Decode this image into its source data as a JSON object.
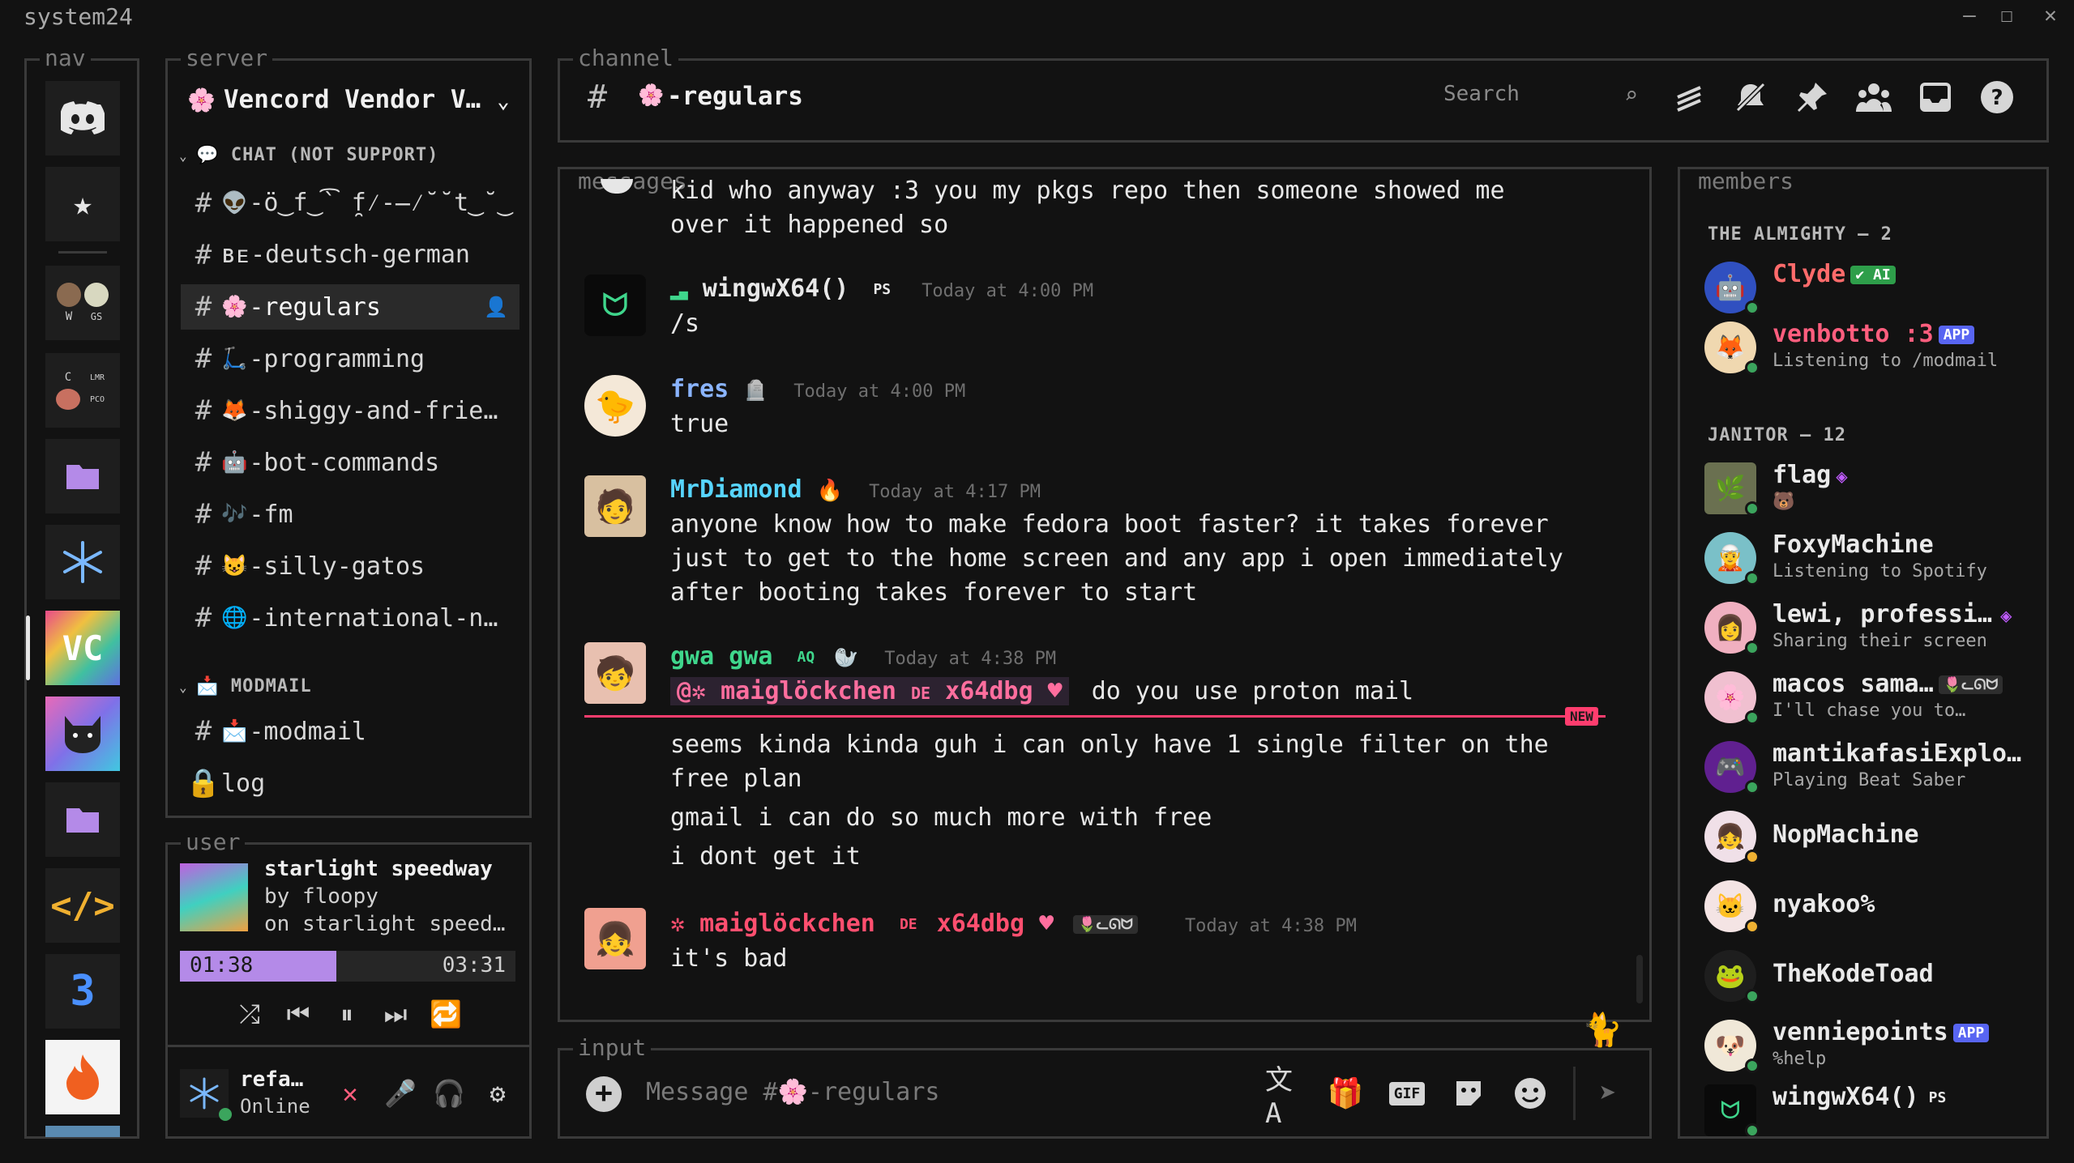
{
  "app_title": "system24",
  "window": {
    "minimize": "—",
    "maximize": "☐",
    "close": "✕"
  },
  "sections": {
    "nav": "nav",
    "server": "server",
    "channel": "channel",
    "messages": "messages",
    "members": "members",
    "user": "user",
    "input": "input"
  },
  "nav": {
    "tiles": [
      {
        "name": "home-discord-icon",
        "label": ""
      },
      {
        "name": "favorites-star-icon",
        "label": "★"
      },
      {
        "name": "server-folder-w-gs",
        "labels": [
          "W",
          "GS"
        ]
      },
      {
        "name": "server-folder-c-lmr-pco",
        "labels": [
          "C",
          "LMR",
          "PCO"
        ]
      },
      {
        "name": "folder-icon",
        "label": ""
      },
      {
        "name": "vencord-server-icon",
        "label": ""
      },
      {
        "name": "vc-server-icon",
        "label": ""
      },
      {
        "name": "cat-server-icon",
        "label": ""
      },
      {
        "name": "folder-icon",
        "label": ""
      },
      {
        "name": "code-server-icon",
        "label": "</>"
      },
      {
        "name": "b3-server-icon",
        "label": "3"
      },
      {
        "name": "fire-server-icon",
        "label": ""
      }
    ]
  },
  "server": {
    "name": "Vencord Vendor V…",
    "categories": [
      {
        "label": "CHAT (NOT SUPPORT)",
        "icon": "💬"
      },
      {
        "label": "MODMAIL",
        "icon": "📩"
      }
    ],
    "channels": [
      {
        "emoji": "👽",
        "label": "-ö‿f‿̀͡ ̯f⁄-̶⁄˘˘t‿˘‿",
        "unread": true
      },
      {
        "emoji": "",
        "label": "ʙᴇ-deutsch-german",
        "unread": true
      },
      {
        "emoji": "🌸",
        "label": "-regulars",
        "selected": true
      },
      {
        "emoji": "🛴",
        "label": "-programming"
      },
      {
        "emoji": "🦊",
        "label": "-shiggy-and-frie…",
        "unread": true
      },
      {
        "emoji": "🤖",
        "label": "-bot-commands",
        "unread": true
      },
      {
        "emoji": "🎶",
        "label": "-fm",
        "unread": true
      },
      {
        "emoji": "😺",
        "label": "-silly-gatos",
        "unread": true
      },
      {
        "emoji": "🌐",
        "label": "-international-n…",
        "unread": true
      },
      {
        "emoji": "📩",
        "label": "-modmail"
      },
      {
        "emoji": "",
        "label": "log",
        "locked": true
      }
    ]
  },
  "header": {
    "channel_emoji": "🌸",
    "channel_name": "-regulars",
    "search_placeholder": "Search"
  },
  "messages": {
    "top_lines": [
      "kid who anyway :3 you my pkgs repo then someone showed me",
      "over it happened so"
    ],
    "items": [
      {
        "author": "wingwX64()",
        "tag": "PS",
        "time": "Today at 4:00 PM",
        "color": "#e8e8e8",
        "lines": [
          "/s"
        ]
      },
      {
        "author": "fres",
        "time": "Today at 4:00 PM",
        "color": "#8ab4ff",
        "lines": [
          "true"
        ]
      },
      {
        "author": "MrDiamond",
        "time": "Today at 4:17 PM",
        "color": "#57d5ff",
        "lines": [
          "anyone know how to make fedora boot faster? it takes forever",
          "just to get to the home screen and any app i open immediately",
          "after booting takes forever to start"
        ]
      },
      {
        "author": "gwa gwa",
        "tag": "AQ",
        "time": "Today at 4:38 PM",
        "color": "#3fd68c",
        "mention": "@✲ maiglöckchen",
        "mention_tag": "DE",
        "mention_suffix": "x64dbg",
        "mention_text": "do you use proton mail",
        "lines": [
          "seems kinda kinda guh i can only have 1 single filter on the",
          "free plan",
          "gmail i can do so much more with free",
          "i dont get it"
        ]
      },
      {
        "author": "maiglöckchen",
        "prefix": "✲",
        "tag": "DE",
        "suffix": "x64dbg",
        "badge": "🌷ᓚᘏᗢ",
        "time": "Today at 4:38 PM",
        "color": "#ff4f6f",
        "lines": [
          "it's bad"
        ]
      }
    ],
    "new_label": "NEW"
  },
  "input": {
    "placeholder": "Message #🌸-regulars"
  },
  "members": {
    "groups": [
      {
        "label": "THE ALMIGHTY — 2",
        "members": [
          {
            "name": "Clyde",
            "color": "#ff6b6b",
            "tag": "✔ AI",
            "tag_color": "#2e9e4a",
            "status": "online"
          },
          {
            "name": "venbotto :3",
            "color": "#ff5e7e",
            "tag": "APP",
            "tag_color": "#5865f2",
            "sub": "Listening to /modmail",
            "status": "online"
          }
        ]
      },
      {
        "label": "JANITOR — 12",
        "members": [
          {
            "name": "flag",
            "color": "#eaeaea",
            "sub": "🐻",
            "status": "online"
          },
          {
            "name": "FoxyMachine",
            "color": "#eaeaea",
            "sub": "Listening to Spotify",
            "status": "online"
          },
          {
            "name": "lewi, professi…",
            "color": "#eaeaea",
            "sub": "Sharing their screen",
            "status": "online"
          },
          {
            "name": "macos sama…",
            "color": "#eaeaea",
            "tag": "🌷ᓚᘏᗢ",
            "sub": "I'll chase you to…",
            "status": "online"
          },
          {
            "name": "mantikafasiExplo…",
            "color": "#eaeaea",
            "sub": "Playing Beat Saber",
            "status": "online"
          },
          {
            "name": "NopMachine",
            "color": "#eaeaea",
            "status": "idle"
          },
          {
            "name": "nyakoo%",
            "color": "#eaeaea",
            "status": "idle"
          },
          {
            "name": "TheKodeToad",
            "color": "#eaeaea",
            "status": "online"
          },
          {
            "name": "venniepoints",
            "color": "#eaeaea",
            "tag": "APP",
            "tag_color": "#5865f2",
            "sub": "%help",
            "status": "online"
          },
          {
            "name": "wingwX64()",
            "color": "#eaeaea",
            "tag": "PS",
            "status": "online"
          }
        ]
      }
    ]
  },
  "user_panel": {
    "track": "starlight speedway",
    "artist": "by floopy",
    "album": "on starlight speed…",
    "elapsed": "01:38",
    "duration": "03:31",
    "progress": 0.465,
    "username": "refa…",
    "status": "Online"
  },
  "colors": {
    "accent": "#b48ae8",
    "new": "#ff3d6e",
    "online": "#3ba55d",
    "idle": "#f0b232"
  }
}
